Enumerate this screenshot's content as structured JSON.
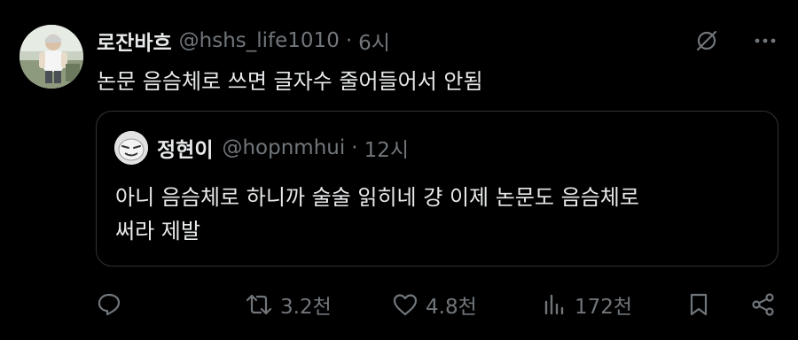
{
  "tweet": {
    "display_name": "로잔바흐",
    "handle": "@hshs_life1010",
    "separator": "·",
    "time": "6시",
    "text": "논문 음슴체로 쓰면 글자수 줄어들어서 안됨",
    "avatar_icon": "profile-photo",
    "top_icons": [
      "grok-icon",
      "more-icon"
    ]
  },
  "quote": {
    "display_name": "정현이",
    "handle": "@hopnmhui",
    "separator": "·",
    "time": "12시",
    "text_line1": "아니 음슴체로 하니까 술술 읽히네 걍 이제 논문도  음슴체로",
    "text_line2": "써라 제발",
    "avatar_icon": "cartoon-face"
  },
  "actions": {
    "reply": {
      "icon": "reply-icon",
      "count": ""
    },
    "retweet": {
      "icon": "retweet-icon",
      "count": "3.2천"
    },
    "like": {
      "icon": "heart-icon",
      "count": "4.8천"
    },
    "views": {
      "icon": "views-icon",
      "count": "172천"
    },
    "bookmark": {
      "icon": "bookmark-icon"
    },
    "share": {
      "icon": "share-icon"
    }
  },
  "colors": {
    "background": "#000000",
    "primary_text": "#e7e9ea",
    "secondary_text": "#71767b",
    "border": "#2f3336"
  }
}
